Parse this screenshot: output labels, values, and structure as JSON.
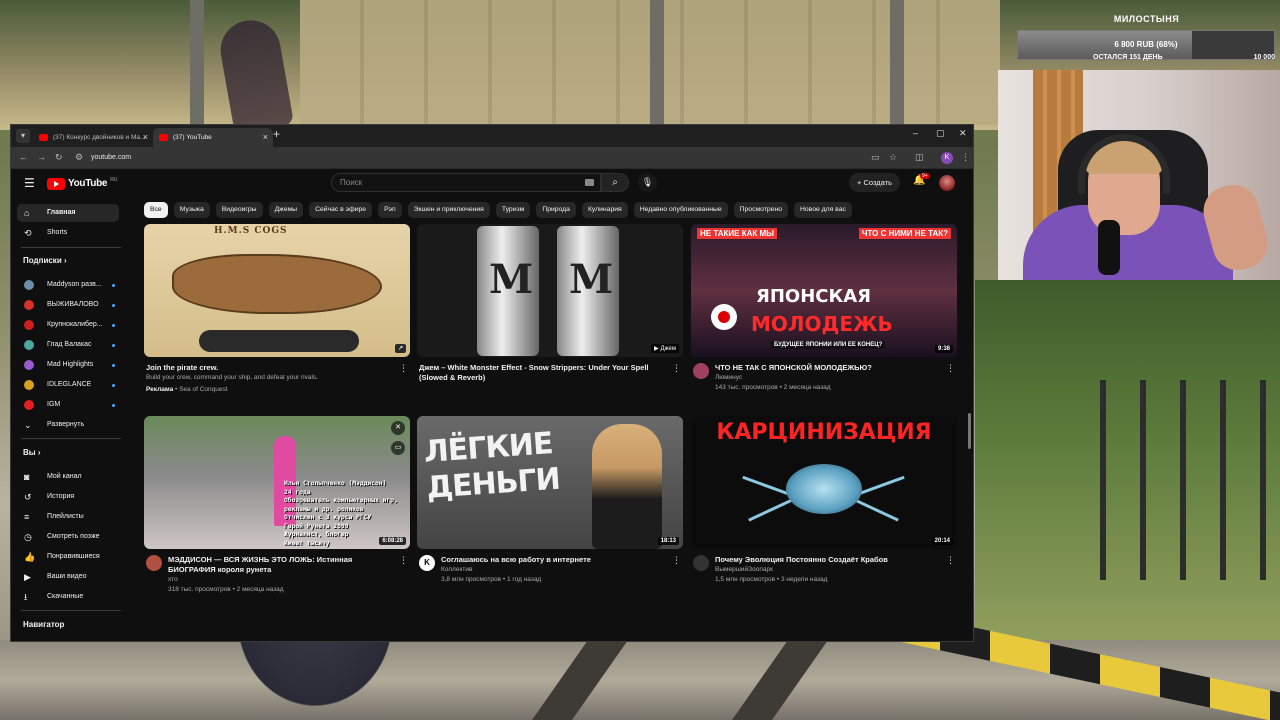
{
  "donation": {
    "title": "МИЛОСТЫНЯ",
    "amount": "6 800 RUB (68%)",
    "progress_pct": 68,
    "days_left": "ОСТАЛСЯ 151 ДЕНЬ",
    "goal": "10 000"
  },
  "browser": {
    "tabs": [
      {
        "label": "(37) Конкурс двойников и Ma...",
        "active": false
      },
      {
        "label": "(37) YouTube",
        "active": true
      }
    ],
    "url": "youtube.com",
    "profile_letter": "K"
  },
  "youtube": {
    "logo_text": "YouTube",
    "logo_region": "RU",
    "search_placeholder": "Поиск",
    "create_label": "Создать",
    "notif_count": "9+",
    "chips": [
      "Все",
      "Музыка",
      "Видеоигры",
      "Джемы",
      "Сейчас в эфире",
      "Рэп",
      "Экшен и приключения",
      "Туризм",
      "Природа",
      "Кулинария",
      "Недавно опубликованные",
      "Просмотрено",
      "Новое для вас"
    ],
    "sidebar": {
      "main": [
        {
          "label": "Главная",
          "icon": "home-icon"
        },
        {
          "label": "Shorts",
          "icon": "shorts-icon"
        }
      ],
      "subs_heading": "Подписки",
      "subs": [
        {
          "label": "Maddyson разв...",
          "color": "#6b8fa8"
        },
        {
          "label": "ВЫЖИВАЛОВО",
          "color": "#d8302a"
        },
        {
          "label": "Крупнокалибер...",
          "color": "#cc1f1f"
        },
        {
          "label": "Глад Валакас",
          "color": "#4aa6a0"
        },
        {
          "label": "Mad Highlights",
          "color": "#9a5ad0"
        },
        {
          "label": "IDLEGLANCE",
          "color": "#d8a020"
        },
        {
          "label": "IGM",
          "color": "#e02020"
        }
      ],
      "expand_label": "Развернуть",
      "you_heading": "Вы",
      "you": [
        {
          "label": "Мой канал",
          "icon": "my-channel-icon"
        },
        {
          "label": "История",
          "icon": "history-icon"
        },
        {
          "label": "Плейлисты",
          "icon": "playlists-icon"
        },
        {
          "label": "Смотреть позже",
          "icon": "watch-later-icon"
        },
        {
          "label": "Понравившиеся",
          "icon": "liked-icon"
        },
        {
          "label": "Ваши видео",
          "icon": "your-videos-icon"
        },
        {
          "label": "Скачанные",
          "icon": "downloads-icon"
        }
      ],
      "navigator_heading": "Навигатор"
    },
    "videos": [
      {
        "title": "Join the pirate crew.",
        "line2": "Build your crew, command your ship, and defeat your rivals.",
        "ad": "Реклама",
        "channel": "Sea of Conquest",
        "thumb_title": "H.M.S COGS"
      },
      {
        "title": "Джем – White Monster Effect - Snow Strippers: Under Your Spell (Slowed & Reverb)",
        "badge": "Джем"
      },
      {
        "title": "ЧТО НЕ ТАК С ЯПОНСКОЙ МОЛОДЕЖЬЮ?",
        "channel": "Люминус",
        "stats": "143 тыс. просмотров • 2 месяца назад",
        "duration": "9:38",
        "thumb_a": "НЕ ТАКИЕ КАК МЫ",
        "thumb_b": "ЯПОНСКАЯ",
        "thumb_c": "МОЛОДЕЖЬ",
        "thumb_d": "ЧТО С НИМИ НЕ ТАК?",
        "thumb_e": "БУДУЩЕЕ ЯПОНИИ ИЛИ ЕЕ КОНЕЦ?"
      },
      {
        "title": "МЭДДИСОН — ВСЯ ЖИЗНЬ ЭТО ЛОЖЬ: Истинная БИОГРАФИЯ короля рунета",
        "channel": "хто",
        "stats": "318 тыс. просмотров • 2 месяца назад",
        "duration": "6:08:28",
        "thumb_lines": [
          "Илья Стольпченко (Мэддисон)",
          "24 года",
          "Обозреватель компьютерных игр,",
          "рекламы и др. роликов",
          "Отчислен с 3 курса РГСУ",
          "Герой Рунета 2009",
          "Журналист, блогер",
          "Имеет тысячу"
        ]
      },
      {
        "title": "Соглашаюсь на всю работу в интернете",
        "channel": "Коллектив",
        "stats": "3,8 млн просмотров • 1 год назад",
        "duration": "18:13",
        "thumb_text": "ЛЁГКИЕ ДЕНЬГИ"
      },
      {
        "title": "Почему Эволюция Постоянно Создаёт Крабов",
        "channel": "ВымершийЗоопарк",
        "stats": "1,5 млн просмотров • 3 недели назад",
        "duration": "20:14",
        "thumb_text": "КАРЦИНИЗАЦИЯ"
      }
    ]
  }
}
